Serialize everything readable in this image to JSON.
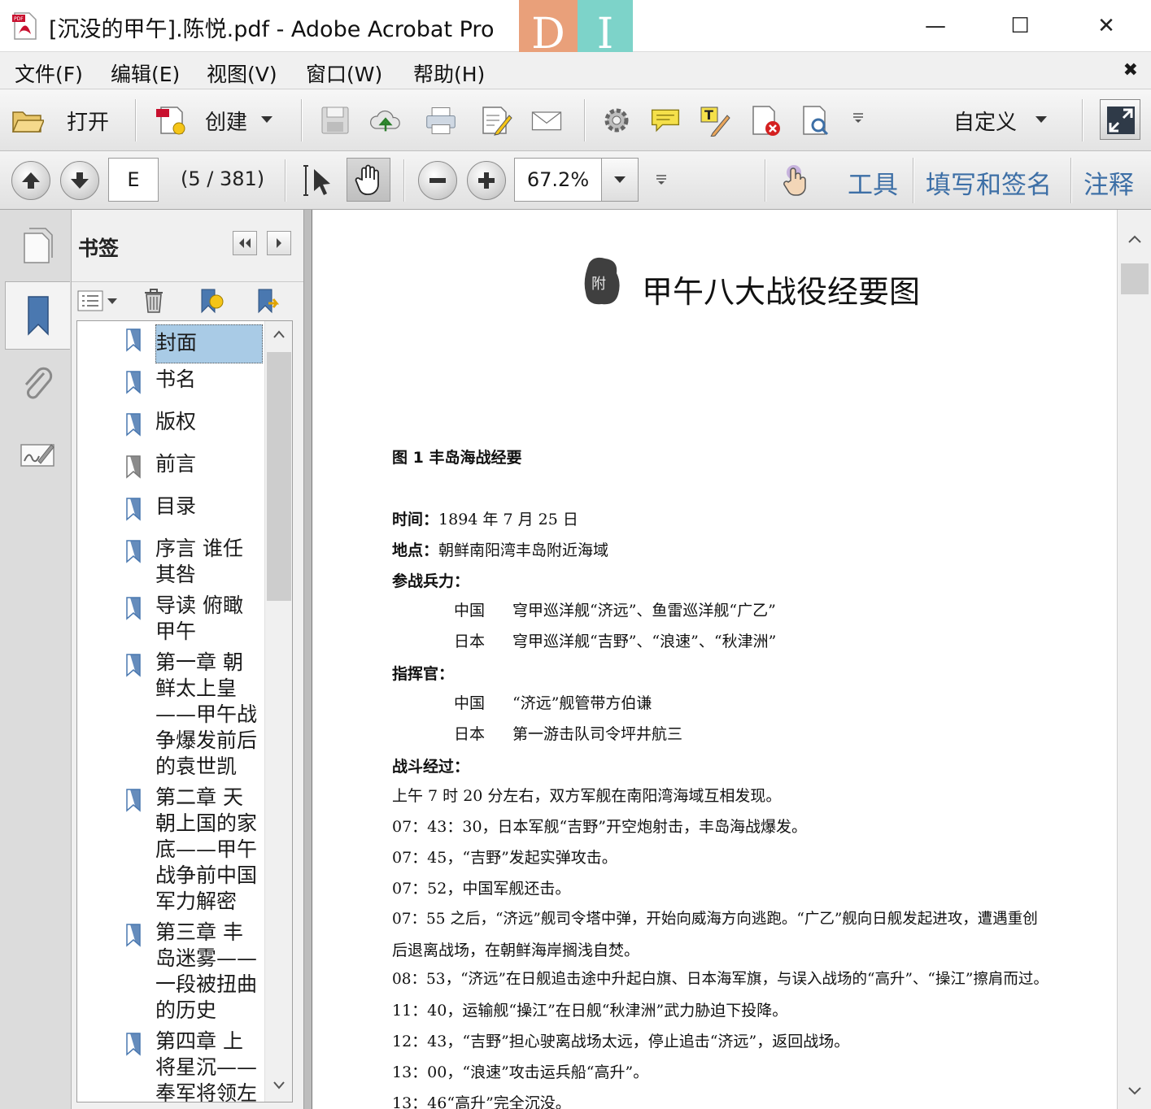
{
  "window": {
    "title": "[沉没的甲午].陈悦.pdf - Adobe Acrobat Pro",
    "watermark_left": "D",
    "watermark_right": "I",
    "minimize": "—",
    "maximize": "☐",
    "close": "✕"
  },
  "menu": [
    "文件(F)",
    "编辑(E)",
    "视图(V)",
    "窗口(W)",
    "帮助(H)"
  ],
  "toolbar": {
    "open_label": "打开",
    "create_label": "创建",
    "customize_label": "自定义"
  },
  "nav": {
    "page_value": "E",
    "page_count": "(5 / 381)",
    "zoom_value": "67.2%",
    "tools_link": "工具",
    "fill_sign_link": "填写和签名",
    "comment_link": "注释"
  },
  "bookmarks": {
    "title": "书签",
    "items": [
      {
        "label": "封面",
        "selected": true,
        "color": "#4a78b0"
      },
      {
        "label": "书名",
        "color": "#4a78b0"
      },
      {
        "label": "版权",
        "color": "#4a78b0"
      },
      {
        "label": "前言",
        "color": "#777777"
      },
      {
        "label": "目录",
        "color": "#4a78b0"
      },
      {
        "label": "序言 谁任其咎",
        "color": "#4a78b0"
      },
      {
        "label": "导读 俯瞰甲午",
        "color": "#4a78b0"
      },
      {
        "label": "第一章 朝鲜太上皇——甲午战争爆发前后的袁世凯",
        "color": "#4a78b0"
      },
      {
        "label": "第二章 天朝上国的家底——甲午战争前中国军力解密",
        "color": "#4a78b0"
      },
      {
        "label": "第三章 丰岛迷雾——一段被扭曲的历史",
        "color": "#4a78b0"
      },
      {
        "label": "第四章 上将星沉——奉军将领左",
        "color": "#4a78b0"
      }
    ]
  },
  "document": {
    "seal_text": "附",
    "heading": "甲午八大战役经要图",
    "figure_title": "图 1  丰岛海战经要",
    "time_label": "时间：",
    "time_value": "1894 年 7 月 25 日",
    "place_label": "地点：",
    "place_value": "朝鲜南阳湾丰岛附近海域",
    "forces_label": "参战兵力：",
    "forces_cn_country": "中国",
    "forces_cn": "穹甲巡洋舰“济远”、鱼雷巡洋舰“广乙”",
    "forces_jp_country": "日本",
    "forces_jp": "穹甲巡洋舰“吉野”、“浪速”、“秋津洲”",
    "commander_label": "指挥官：",
    "commander_cn_country": "中国",
    "commander_cn": "“济远”舰管带方伯谦",
    "commander_jp_country": "日本",
    "commander_jp": "第一游击队司令坪井航三",
    "battle_label": "战斗经过：",
    "battle_lines": [
      "上午 7 时 20 分左右，双方军舰在南阳湾海域互相发现。",
      "07：43：30，日本军舰“吉野”开空炮射击，丰岛海战爆发。",
      "07：45，“吉野”发起实弹攻击。",
      "07：52，中国军舰还击。",
      "07：55 之后，“济远”舰司令塔中弹，开始向威海方向逃跑。“广乙”舰向日舰发起进攻，遭遇重创",
      "后退离战场，在朝鲜海岸搁浅自焚。",
      "08：53，“济远”在日舰追击途中升起白旗、日本海军旗，与误入战场的“高升”、“操江”擦肩而过。",
      "11：40，运输舰“操江”在日舰“秋津洲”武力胁迫下投降。",
      "12：43，“吉野”担心驶离战场太远，停止追击“济远”，返回战场。",
      "13：00，“浪速”攻击运兵船“高升”。",
      "13：46“高升”完全沉没。"
    ]
  }
}
